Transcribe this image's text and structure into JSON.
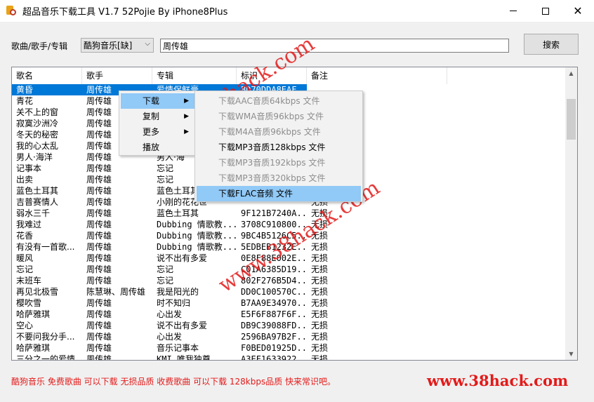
{
  "window": {
    "title": "超品音乐下载工具 V1.7 52Pojie By iPhone8Plus",
    "minimize": "—",
    "close": "✕"
  },
  "search": {
    "label": "歌曲/歌手/专辑",
    "source": "酷狗音乐[缺]",
    "query": "周传雄",
    "button": "搜索"
  },
  "table": {
    "columns": [
      "歌名",
      "歌手",
      "专辑",
      "标识",
      "备注"
    ],
    "rows": [
      [
        "黄昏",
        "周传雄",
        "爱情保鲜膏",
        "BD70DDA8EAF...",
        "无损"
      ],
      [
        "青花",
        "周传雄",
        "",
        "",
        ""
      ],
      [
        "关不上的窗",
        "周传雄",
        "",
        "",
        ""
      ],
      [
        "寂寞沙洲冷",
        "周传雄",
        "",
        "",
        ""
      ],
      [
        "冬天的秘密",
        "周传雄",
        "",
        "",
        ""
      ],
      [
        "我的心太乱",
        "周传雄",
        "",
        "",
        ""
      ],
      [
        "男人·海洋",
        "周传雄",
        "男人·海",
        "",
        ""
      ],
      [
        "记事本",
        "周传雄",
        "忘记",
        "",
        ""
      ],
      [
        "出卖",
        "周传雄",
        "忘记",
        "",
        ""
      ],
      [
        "蓝色土耳其",
        "周传雄",
        "蓝色土耳其",
        "",
        ""
      ],
      [
        "吉普赛情人",
        "周传雄",
        "小刚的花花世",
        "",
        "无损"
      ],
      [
        "弱水三千",
        "周传雄",
        "蓝色土耳其",
        "9F121B7240A...",
        "无损"
      ],
      [
        "我难过",
        "周传雄",
        "Dubbing 情歌教...",
        "3708C910800...",
        "无损"
      ],
      [
        "花香",
        "周传雄",
        "Dubbing 情歌教...",
        "9BC4B5126C5...",
        "无损"
      ],
      [
        "有没有一首歌...",
        "周传雄",
        "Dubbing 情歌教...",
        "5EDBEB1232E...",
        "无损"
      ],
      [
        "暖风",
        "周传雄",
        "说不出有多爱",
        "0E8F88E002E...",
        "无损"
      ],
      [
        "忘记",
        "周传雄",
        "忘记",
        "C01A6385D19...",
        "无损"
      ],
      [
        "末班车",
        "周传雄",
        "忘记",
        "802F276B5D4...",
        "无损"
      ],
      [
        "再见北极雪",
        "陈慧琳、周传雄",
        "我是阳光的",
        "DD0C100570C...",
        "无损"
      ],
      [
        "樱吹雪",
        "周传雄",
        "时不知归",
        "B7AA9E34970...",
        "无损"
      ],
      [
        "哈萨雅琪",
        "周传雄",
        "心出发",
        "E5F6F887F6F...",
        "无损"
      ],
      [
        "空心",
        "周传雄",
        "说不出有多爱",
        "DB9C39088FD...",
        "无损"
      ],
      [
        "不要问我分手...",
        "周传雄",
        "心出发",
        "2596BA97B2F...",
        "无损"
      ],
      [
        "哈萨雅琪",
        "周传雄",
        "音乐记事本",
        "F0BED01925D...",
        "无损"
      ],
      [
        "三分之一的爱情",
        "周传雄",
        "KMI 唯我独尊",
        "A3EF1633922...",
        "无损"
      ]
    ]
  },
  "context_menu": {
    "items": [
      "下载",
      "复制",
      "更多",
      "播放"
    ]
  },
  "download_submenu": {
    "items": [
      "下载AAC音质64kbps 文件",
      "下载WMA音质96kbps 文件",
      "下载M4A音质96kbps 文件",
      "下载MP3音质128kbps 文件",
      "下载MP3音质192kbps 文件",
      "下载MP3音质320kbps 文件",
      "下载FLAC音频 文件"
    ]
  },
  "watermark": "www.38hack.com",
  "footer": {
    "note": "酷狗音乐 免费歌曲 可以下载 无损品质 收费歌曲 可以下载 128kbps品质 快来常识吧。",
    "brand": "www.38hack.com"
  }
}
